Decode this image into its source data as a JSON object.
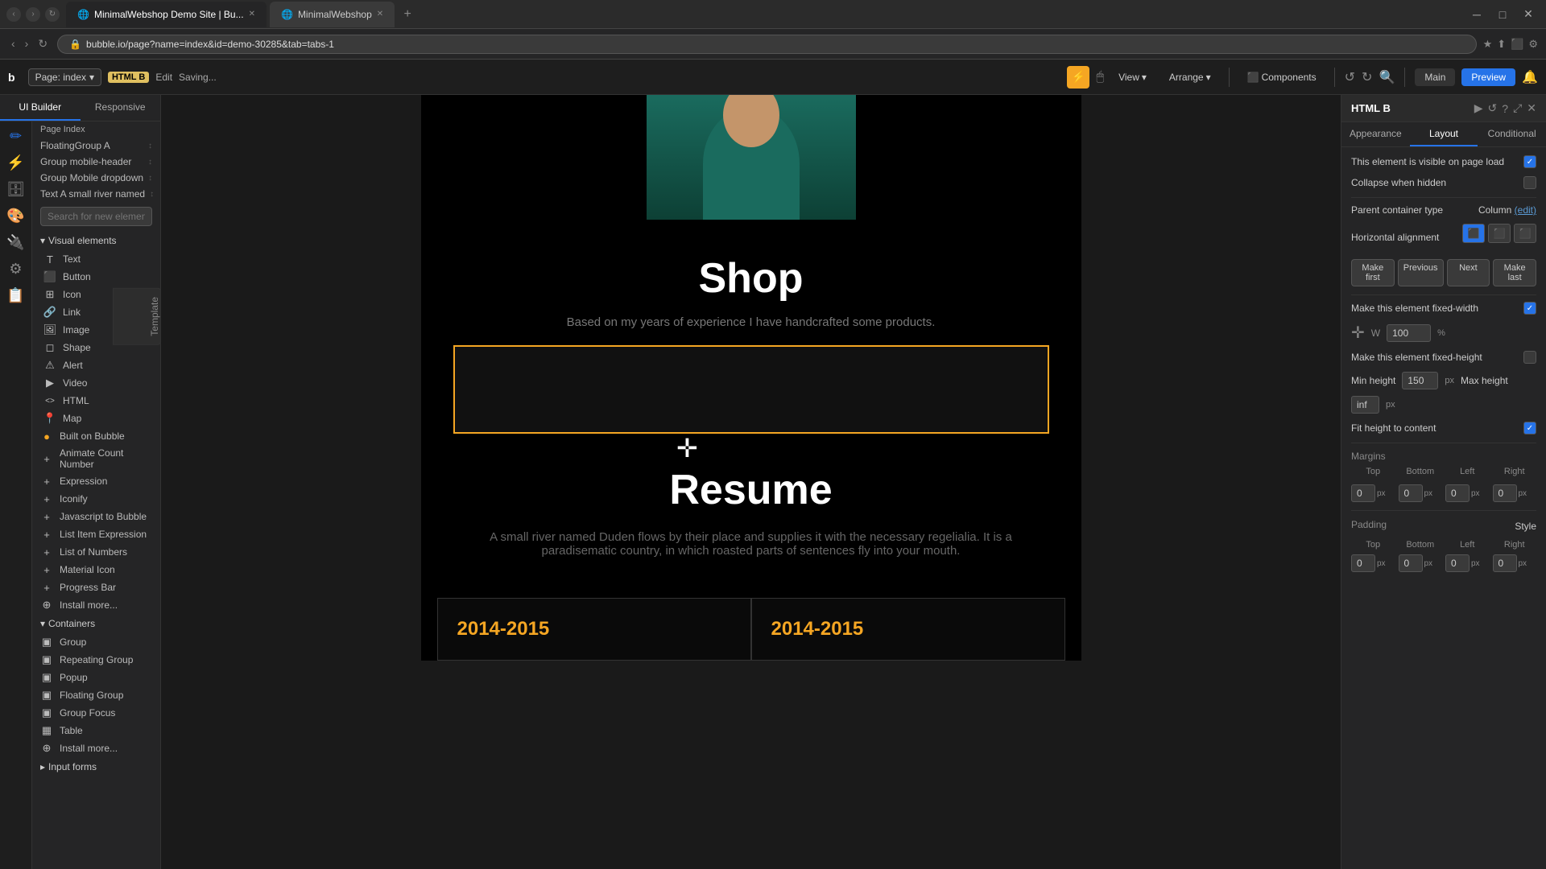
{
  "browser": {
    "tabs": [
      {
        "label": "MinimalWebshop Demo Site | Bu...",
        "active": true,
        "favicon": "🌐"
      },
      {
        "label": "MinimalWebshop",
        "active": false,
        "favicon": "🌐"
      }
    ],
    "new_tab": "+",
    "url": "bubble.io/page?name=index&id=demo-30285&tab=tabs-1",
    "window_controls": [
      "─",
      "□",
      "✕"
    ]
  },
  "bubble_toolbar": {
    "logo": "b",
    "page_label": "Page: index",
    "html_element": "HTML B",
    "edit_label": "Edit",
    "saving_label": "Saving...",
    "view_label": "View",
    "arrange_label": "Arrange",
    "components_label": "Components",
    "main_label": "Main",
    "preview_label": "Preview"
  },
  "left_panel": {
    "tabs": [
      "UI Builder",
      "Responsive"
    ],
    "page_index_label": "Page Index",
    "tree_items": [
      "FloatingGroup A",
      "Group mobile-header",
      "Group Mobile dropdown",
      "Text A small river named"
    ],
    "search_placeholder": "Search for new elements...",
    "visual_elements_label": "Visual elements",
    "elements": [
      {
        "name": "Text",
        "icon": "T"
      },
      {
        "name": "Button",
        "icon": "⬛"
      },
      {
        "name": "Icon",
        "icon": "⊞"
      },
      {
        "name": "Link",
        "icon": "🔗"
      },
      {
        "name": "Image",
        "icon": "🖼"
      },
      {
        "name": "Shape",
        "icon": "◻"
      },
      {
        "name": "Alert",
        "icon": "⚠"
      },
      {
        "name": "Video",
        "icon": "▶"
      },
      {
        "name": "HTML",
        "icon": "<>"
      },
      {
        "name": "Map",
        "icon": "📍"
      }
    ],
    "built_on_bubble": "Built on Bubble",
    "animate_count": "Animate Count Number",
    "expression": "Expression",
    "iconify": "Iconify",
    "javascript_to_bubble": "Javascript to Bubble",
    "list_item_expression": "List Item Expression",
    "list_of_numbers": "List of Numbers",
    "material_icon": "Material Icon",
    "progress_bar": "Progress Bar",
    "install_more_1": "Install more...",
    "containers_label": "Containers",
    "containers": [
      {
        "name": "Group"
      },
      {
        "name": "Repeating Group"
      },
      {
        "name": "Popup"
      },
      {
        "name": "Floating Group"
      },
      {
        "name": "Group Focus"
      },
      {
        "name": "Table"
      }
    ],
    "install_more_2": "Install more...",
    "input_forms_label": "Input forms"
  },
  "template_tab": {
    "label": "Template"
  },
  "canvas": {
    "shop_title": "Shop",
    "shop_subtitle": "Based on my years of experience I have handcrafted some products.",
    "resume_title": "Resume",
    "resume_text": "A small river named Duden flows by their place and supplies it with the necessary regelialia. It is a paradisematic country, in which roasted parts of sentences fly into your mouth.",
    "year1": "2014-2015",
    "year2": "2014-2015"
  },
  "right_panel": {
    "title": "HTML B",
    "tabs": [
      "Appearance",
      "Layout",
      "Conditional"
    ],
    "appearance": {
      "visible_label": "This element is visible on page load",
      "collapse_label": "Collapse when hidden",
      "parent_container_label": "Parent container type",
      "parent_container_value": "Column",
      "parent_edit_link": "(edit)",
      "horizontal_alignment_label": "Horizontal alignment",
      "alignment_options": [
        "⬛",
        "⬛",
        "⬛"
      ],
      "order_btns": [
        "Make first",
        "Previous",
        "Next",
        "Make last"
      ],
      "fixed_width_label": "Make this element fixed-width",
      "width_value": "100",
      "width_unit": "%",
      "fixed_height_label": "Make this element fixed-height",
      "min_height_label": "Min height",
      "min_height_value": "150",
      "min_height_unit": "px",
      "max_height_label": "Max height",
      "max_height_value": "inf",
      "max_height_unit": "px",
      "fit_height_label": "Fit height to content",
      "margins_label": "Margins",
      "margin_top": "0",
      "margin_bottom": "0",
      "margin_left": "0",
      "margin_right": "0",
      "margin_unit": "px",
      "padding_label": "Padding",
      "padding_style_label": "Style",
      "padding_top": "0",
      "padding_bottom": "0",
      "padding_left": "0",
      "padding_right": "0",
      "padding_unit": "px",
      "top_label": "Top",
      "bottom_label": "Bottom",
      "left_label": "Left",
      "right_label": "Right"
    }
  }
}
